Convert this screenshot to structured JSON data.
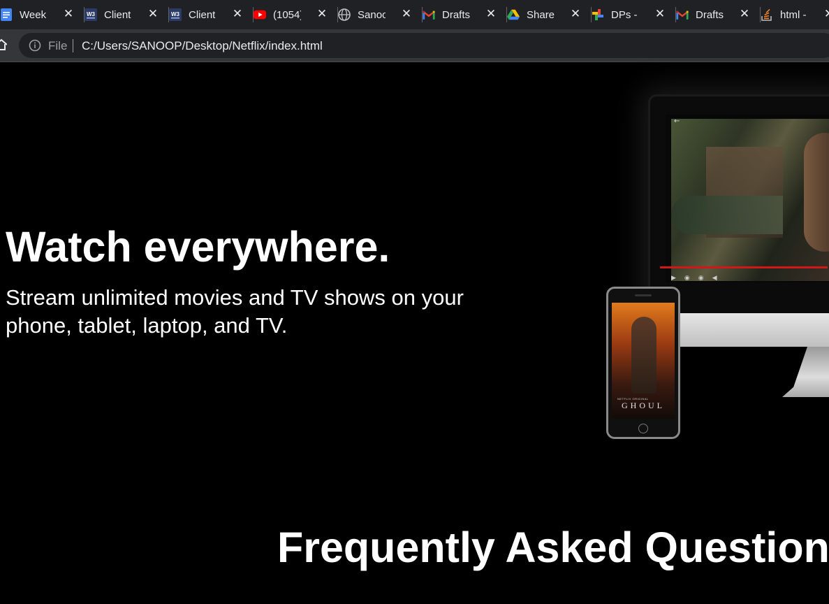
{
  "browser": {
    "tabs": [
      {
        "title": "Week",
        "icon": "google-docs-icon"
      },
      {
        "title": "Client",
        "icon": "w3layouts-icon"
      },
      {
        "title": "Client",
        "icon": "w3layouts-icon"
      },
      {
        "title": "(1054)",
        "icon": "youtube-icon"
      },
      {
        "title": "Sanoo",
        "icon": "globe-icon"
      },
      {
        "title": "Drafts",
        "icon": "gmail-icon"
      },
      {
        "title": "Share",
        "icon": "google-drive-icon"
      },
      {
        "title": "DPs -",
        "icon": "google-photos-icon"
      },
      {
        "title": "Drafts",
        "icon": "gmail-icon"
      },
      {
        "title": "html -",
        "icon": "stackoverflow-icon"
      }
    ],
    "close_glyph": "✕",
    "address_bar": {
      "scheme_label": "File",
      "url": "C:/Users/SANOOP/Desktop/Netflix/index.html"
    }
  },
  "page": {
    "headline": "Watch everywhere.",
    "subtext": "Stream unlimited movies and TV shows on your phone, tablet, laptop, and TV.",
    "faq_heading": "Frequently Asked Questions",
    "phone_poster_brand": "NETFLIX ORIGINAL",
    "phone_poster_title": "GHOUL"
  },
  "colors": {
    "page_background": "#000000",
    "tabstrip_background": "#202124",
    "toolbar_background": "#35363a",
    "omnibox_background": "#202124",
    "progress_red": "#d01818"
  }
}
